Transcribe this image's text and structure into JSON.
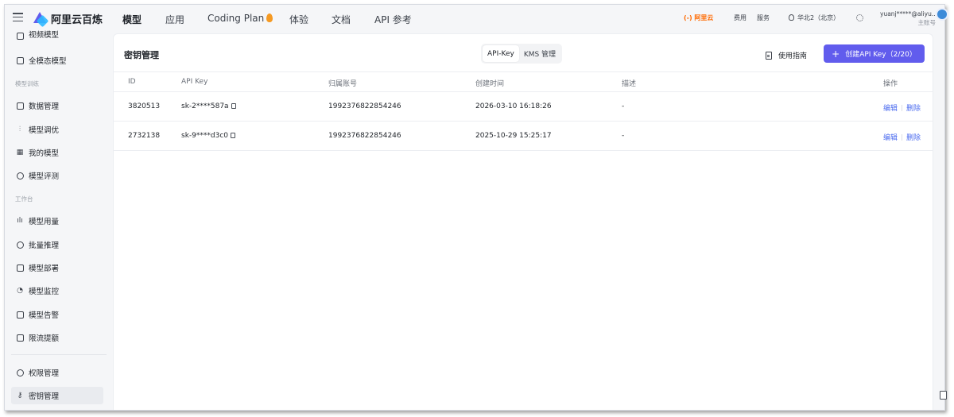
{
  "header": {
    "brand": "阿里云百炼",
    "nav": [
      "模型",
      "应用",
      "Coding Plan",
      "体验",
      "文档",
      "API 参考"
    ],
    "aliyun_logo": "(-) 阿里云",
    "tools": [
      "费用",
      "服务"
    ],
    "region": "华北2（北京）",
    "user": "yuanj*****@aliyu...",
    "account_type": "主账号"
  },
  "sidebar": {
    "top_cut": "视频模型",
    "items_a": [
      "全模态模型"
    ],
    "group_training": "模型训练",
    "items_b": [
      "数据管理",
      "模型调优",
      "我的模型",
      "模型评测"
    ],
    "group_workbench": "工作台",
    "items_c": [
      "模型用量",
      "批量推理",
      "模型部署",
      "模型监控",
      "模型告警",
      "限流提额"
    ],
    "items_d": [
      "权限管理",
      "密钥管理"
    ]
  },
  "panel": {
    "title": "密钥管理",
    "tabs": [
      "API-Key",
      "KMS 管理"
    ],
    "guide": "使用指南",
    "create_button": "创建API Key（2/20）"
  },
  "table": {
    "headers": [
      "ID",
      "API Key",
      "归属账号",
      "创建时间",
      "描述",
      "操作"
    ],
    "rows": [
      {
        "id": "3820513",
        "key": "sk-2****587a",
        "account": "1992376822854246",
        "created": "2026-03-10 16:18:26",
        "desc": "-",
        "edit": "编辑",
        "delete": "删除"
      },
      {
        "id": "2732138",
        "key": "sk-9****d3c0",
        "account": "1992376822854246",
        "created": "2025-10-29 15:25:17",
        "desc": "-",
        "edit": "编辑",
        "delete": "删除"
      }
    ]
  },
  "colors": {
    "accent": "#615ced",
    "link": "#4b6bef",
    "aliyun_orange": "#ff6a00"
  }
}
